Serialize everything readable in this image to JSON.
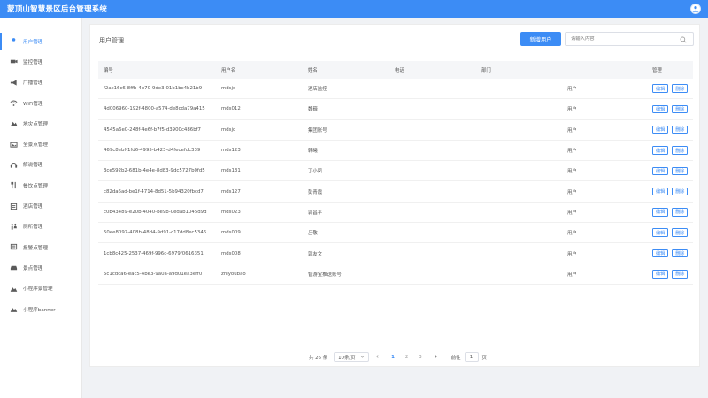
{
  "app": {
    "title": "蒙顶山智慧景区后台管理系统"
  },
  "sidebar": {
    "items": [
      {
        "label": "用户管理",
        "icon": "user-icon",
        "active": true
      },
      {
        "label": "监控管理",
        "icon": "camera-icon"
      },
      {
        "label": "广播管理",
        "icon": "megaphone-icon"
      },
      {
        "label": "WiFi管理",
        "icon": "wifi-icon"
      },
      {
        "label": "地灾点管理",
        "icon": "landslide-icon"
      },
      {
        "label": "全景点管理",
        "icon": "panorama-icon"
      },
      {
        "label": "解说管理",
        "icon": "headphones-icon"
      },
      {
        "label": "餐饮点管理",
        "icon": "cutlery-icon"
      },
      {
        "label": "酒店管理",
        "icon": "hotel-icon"
      },
      {
        "label": "厕所管理",
        "icon": "restroom-icon"
      },
      {
        "label": "报警点管理",
        "icon": "alarm-icon"
      },
      {
        "label": "景点管理",
        "icon": "car-icon"
      },
      {
        "label": "小程序景管理",
        "icon": "landscape-icon"
      },
      {
        "label": "小程序banner",
        "icon": "banner-icon"
      }
    ]
  },
  "main": {
    "title": "用户管理",
    "add_button": "新增用户",
    "search_placeholder": "请输入内容"
  },
  "table": {
    "headers": {
      "id": "编号",
      "username": "用户名",
      "name": "姓名",
      "phone": "电话",
      "dept": "部门",
      "role": "",
      "ops": "管理"
    },
    "edit_label": "编辑",
    "delete_label": "删除",
    "rows": [
      {
        "id": "f2ac16c6-8ffb-4b70-9de3-01b1bc4b21b9",
        "username": "mdsjd",
        "name": "酒店监控",
        "phone": "",
        "dept": "",
        "role": "用户"
      },
      {
        "id": "4d006960-192f-4800-a574-de8cda79a415",
        "username": "mds012",
        "name": "魏巍",
        "phone": "",
        "dept": "",
        "role": "用户"
      },
      {
        "id": "4545a6e0-248f-4e6f-b7f5-d3900c486bf7",
        "username": "mdsjq",
        "name": "集团账号",
        "phone": "",
        "dept": "",
        "role": "用户"
      },
      {
        "id": "469c8ebf-1fd6-4995-b423-d4fecefdc339",
        "username": "mds123",
        "name": "韩曦",
        "phone": "",
        "dept": "",
        "role": "用户"
      },
      {
        "id": "3ce592b2-681b-4e4e-8d83-9dc5727b0fd5",
        "username": "mds131",
        "name": "丁小凤",
        "phone": "",
        "dept": "",
        "role": "用户"
      },
      {
        "id": "c82da6ad-be1f-4714-8d51-5b94320fbcd7",
        "username": "mds127",
        "name": "彭青霞",
        "phone": "",
        "dept": "",
        "role": "用户"
      },
      {
        "id": "c0b43489-e20b-4040-be9b-0edab1045d9d",
        "username": "mds023",
        "name": "郭昌平",
        "phone": "",
        "dept": "",
        "role": "用户"
      },
      {
        "id": "50ee8097-408b-48d4-9d91-c17dd8ec5346",
        "username": "mds009",
        "name": "吕敬",
        "phone": "",
        "dept": "",
        "role": "用户"
      },
      {
        "id": "1cb8c425-2537-469f-996c-6979f0616351",
        "username": "mds008",
        "name": "郭友文",
        "phone": "",
        "dept": "",
        "role": "用户"
      },
      {
        "id": "5c1cdca6-eac5-4be3-9a0a-a9d01ea3eff0",
        "username": "zhiyoubao",
        "name": "智游宝推送账号",
        "phone": "",
        "dept": "",
        "role": "用户"
      }
    ]
  },
  "pagination": {
    "total": "共 26 条",
    "page_size": "10条/页",
    "pages": [
      "1",
      "2",
      "3"
    ],
    "current_page": "1",
    "goto_prefix": "前往",
    "goto_value": "1",
    "goto_suffix": "页"
  },
  "colors": {
    "primary": "#3c8cf5"
  }
}
